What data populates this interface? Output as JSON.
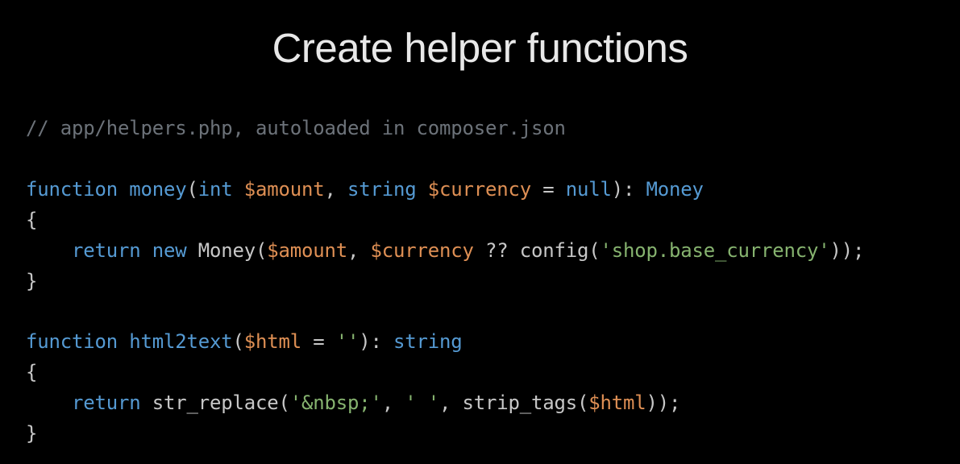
{
  "title": "Create helper functions",
  "code": {
    "comment": "// app/helpers.php, autoloaded in composer.json",
    "fn1": {
      "keyword_function": "function",
      "name": "money",
      "paren_open": "(",
      "param1_type": "int",
      "param1_var": "$amount",
      "comma1": ", ",
      "param2_type": "string",
      "param2_var": "$currency",
      "param2_eq": " = ",
      "param2_default": "null",
      "paren_close": ")",
      "colon": ": ",
      "return_type": "Money",
      "brace_open": "{",
      "indent": "    ",
      "return_kw": "return",
      "new_kw": "new",
      "class_name": "Money",
      "call_open": "(",
      "arg1": "$amount",
      "comma2": ", ",
      "arg2": "$currency",
      "null_coalesce": " ?? ",
      "config_fn": "config",
      "config_open": "(",
      "config_str": "'shop.base_currency'",
      "config_close": ")",
      "call_close": ")",
      "semicolon": ";",
      "brace_close": "}"
    },
    "fn2": {
      "keyword_function": "function",
      "name": "html2text",
      "paren_open": "(",
      "param1_var": "$html",
      "param1_eq": " = ",
      "param1_default": "''",
      "paren_close": ")",
      "colon": ": ",
      "return_type": "string",
      "brace_open": "{",
      "indent": "    ",
      "return_kw": "return",
      "str_replace_fn": "str_replace",
      "sr_open": "(",
      "sr_arg1": "'&nbsp;'",
      "sr_comma1": ", ",
      "sr_arg2": "' '",
      "sr_comma2": ", ",
      "strip_tags_fn": "strip_tags",
      "st_open": "(",
      "st_arg": "$html",
      "st_close": ")",
      "sr_close": ")",
      "semicolon": ";",
      "brace_close": "}"
    }
  }
}
